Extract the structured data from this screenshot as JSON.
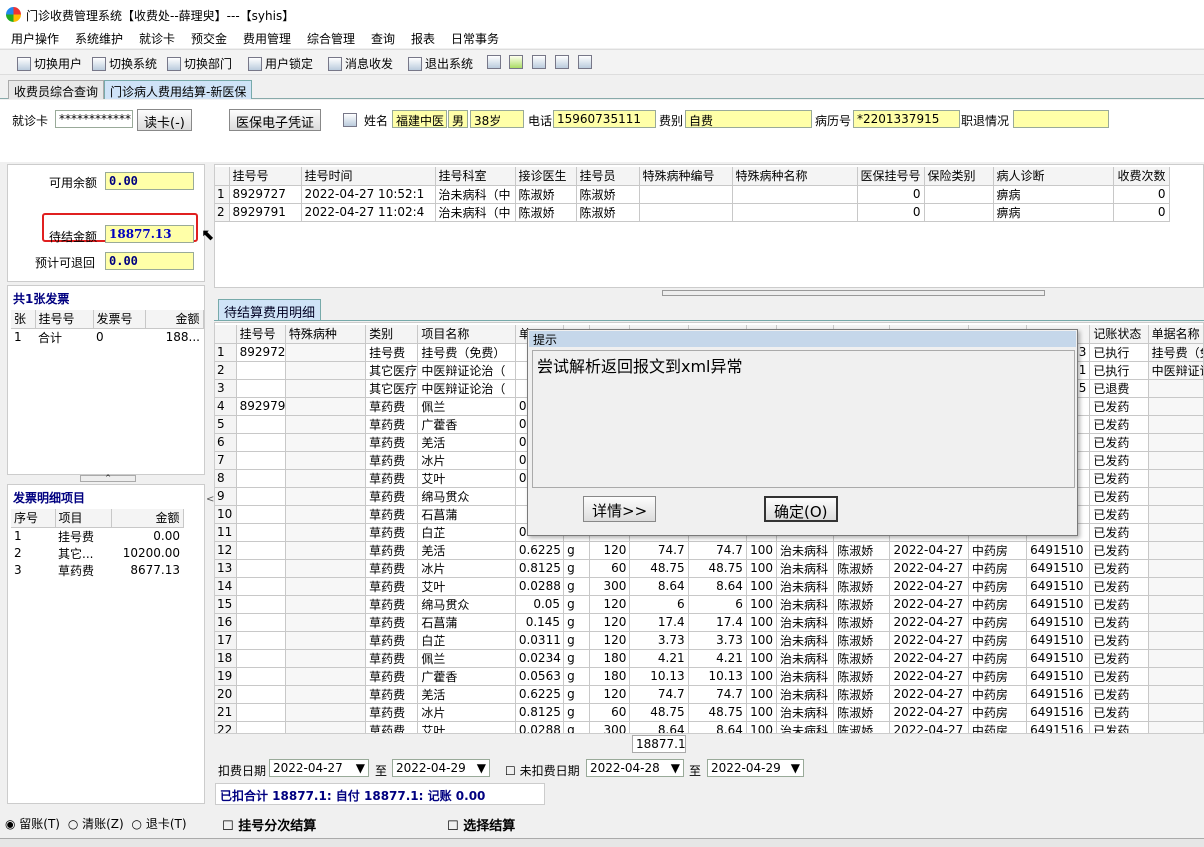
{
  "window": {
    "title": "门诊收费管理系统【收费处--薛理臾】---【syhis】"
  },
  "menu": [
    "用户操作",
    "系统维护",
    "就诊卡",
    "预交金",
    "费用管理",
    "综合管理",
    "查询",
    "报表",
    "日常事务"
  ],
  "toolbar": {
    "switch_user": "切换用户",
    "switch_system": "切换系统",
    "switch_dept": "切换部门",
    "user_lock": "用户锁定",
    "messages": "消息收发",
    "exit": "退出系统"
  },
  "tabs": [
    "收费员综合查询",
    "门诊病人费用结算-新医保"
  ],
  "patient": {
    "card_label": "就诊卡",
    "card_value": "************",
    "read_card": "读卡(-)",
    "medical_voucher": "医保电子凭证",
    "name_label": "姓名",
    "name": "福建中医",
    "gender": "男",
    "age": "38岁",
    "phone_label": "电话",
    "phone": "15960735111",
    "fee_type_label": "费别",
    "fee_type": "自费",
    "record_label": "病历号",
    "record": "*2201337915",
    "refund_label": "职退情况",
    "refund": ""
  },
  "balance": {
    "available_label": "可用余额",
    "available": "0.00",
    "pending_label": "待结金额",
    "pending": "18877.13",
    "refund_label": "预计可退回",
    "refund": "0.00"
  },
  "invoices": {
    "title": "共1张发票",
    "headers": [
      "张",
      "挂号号",
      "发票号",
      "金额"
    ],
    "rows": [
      [
        "1",
        "合计",
        "0",
        "188..."
      ]
    ]
  },
  "invoice_detail": {
    "title": "发票明细项目",
    "headers": [
      "序号",
      "项目",
      "金额"
    ],
    "rows": [
      [
        "1",
        "挂号费",
        "0.00"
      ],
      [
        "2",
        "其它...",
        "10200.00"
      ],
      [
        "3",
        "草药费",
        "8677.13"
      ]
    ]
  },
  "registrations": {
    "headers": [
      "挂号号",
      "挂号时间",
      "挂号科室",
      "接诊医生",
      "挂号员",
      "特殊病种编号",
      "特殊病种名称",
      "医保挂号号",
      "保险类别",
      "病人诊断",
      "收费次数"
    ],
    "rows": [
      [
        "1",
        "8929727",
        "2022-04-27 10:52:1",
        "治未病科（中",
        "陈淑娇",
        "陈淑娇",
        "",
        "",
        "0",
        "",
        "痹病",
        "0"
      ],
      [
        "2",
        "8929791",
        "2022-04-27 11:02:4",
        "治未病科（中",
        "陈淑娇",
        "陈淑娇",
        "",
        "",
        "0",
        "",
        "痹病",
        "0"
      ]
    ]
  },
  "detail": {
    "tab": "待结算费用明细",
    "headers_left": [
      "挂号号",
      "特殊病种",
      "类别",
      "项目名称",
      "单"
    ],
    "headers_right": [
      "记账状态",
      "单据名称"
    ],
    "left_rows": [
      [
        "1",
        "892972",
        "",
        "挂号费",
        "挂号费（免费）",
        ""
      ],
      [
        "2",
        "",
        "",
        "其它医疗",
        "中医辩证论治（",
        ""
      ],
      [
        "3",
        "",
        "",
        "其它医疗",
        "中医辩证论治（",
        ""
      ],
      [
        "4",
        "892979",
        "",
        "草药费",
        "佩兰",
        "0."
      ],
      [
        "5",
        "",
        "",
        "草药费",
        "广藿香",
        "0."
      ],
      [
        "6",
        "",
        "",
        "草药费",
        "羌活",
        "0."
      ],
      [
        "7",
        "",
        "",
        "草药费",
        "冰片",
        "0."
      ],
      [
        "8",
        "",
        "",
        "草药费",
        "艾叶",
        "0."
      ],
      [
        "9",
        "",
        "",
        "草药费",
        "绵马贯众",
        ""
      ],
      [
        "10",
        "",
        "",
        "草药费",
        "石菖蒲",
        ""
      ],
      [
        "11",
        "",
        "",
        "草药费",
        "白芷",
        "0."
      ]
    ],
    "right_rows": [
      [
        "已执行",
        "挂号费（免"
      ],
      [
        "已执行",
        "中医辩证论"
      ],
      [
        "已退费",
        ""
      ],
      [
        "已发药",
        ""
      ],
      [
        "已发药",
        ""
      ],
      [
        "已发药",
        ""
      ],
      [
        "已发药",
        ""
      ],
      [
        "已发药",
        ""
      ],
      [
        "已发药",
        ""
      ],
      [
        "已发药",
        ""
      ],
      [
        "已发药",
        ""
      ]
    ],
    "right_clip": [
      "3",
      "1",
      "5",
      "",
      "",
      "",
      "",
      "",
      "",
      "",
      ""
    ],
    "full_rows": [
      [
        "12",
        "草药费",
        "羌活",
        "0.6225",
        "g",
        "120",
        "74.7",
        "74.7",
        "100",
        "治未病科",
        "陈淑娇",
        "2022-04-27",
        "中药房",
        "6491510",
        "已发药"
      ],
      [
        "13",
        "草药费",
        "冰片",
        "0.8125",
        "g",
        "60",
        "48.75",
        "48.75",
        "100",
        "治未病科",
        "陈淑娇",
        "2022-04-27",
        "中药房",
        "6491510",
        "已发药"
      ],
      [
        "14",
        "草药费",
        "艾叶",
        "0.0288",
        "g",
        "300",
        "8.64",
        "8.64",
        "100",
        "治未病科",
        "陈淑娇",
        "2022-04-27",
        "中药房",
        "6491510",
        "已发药"
      ],
      [
        "15",
        "草药费",
        "绵马贯众",
        "0.05",
        "g",
        "120",
        "6",
        "6",
        "100",
        "治未病科",
        "陈淑娇",
        "2022-04-27",
        "中药房",
        "6491510",
        "已发药"
      ],
      [
        "16",
        "草药费",
        "石菖蒲",
        "0.145",
        "g",
        "120",
        "17.4",
        "17.4",
        "100",
        "治未病科",
        "陈淑娇",
        "2022-04-27",
        "中药房",
        "6491510",
        "已发药"
      ],
      [
        "17",
        "草药费",
        "白芷",
        "0.0311",
        "g",
        "120",
        "3.73",
        "3.73",
        "100",
        "治未病科",
        "陈淑娇",
        "2022-04-27",
        "中药房",
        "6491510",
        "已发药"
      ],
      [
        "18",
        "草药费",
        "佩兰",
        "0.0234",
        "g",
        "180",
        "4.21",
        "4.21",
        "100",
        "治未病科",
        "陈淑娇",
        "2022-04-27",
        "中药房",
        "6491510",
        "已发药"
      ],
      [
        "19",
        "草药费",
        "广藿香",
        "0.0563",
        "g",
        "180",
        "10.13",
        "10.13",
        "100",
        "治未病科",
        "陈淑娇",
        "2022-04-27",
        "中药房",
        "6491510",
        "已发药"
      ],
      [
        "20",
        "草药费",
        "羌活",
        "0.6225",
        "g",
        "120",
        "74.7",
        "74.7",
        "100",
        "治未病科",
        "陈淑娇",
        "2022-04-27",
        "中药房",
        "6491516",
        "已发药"
      ],
      [
        "21",
        "草药费",
        "冰片",
        "0.8125",
        "g",
        "60",
        "48.75",
        "48.75",
        "100",
        "治未病科",
        "陈淑娇",
        "2022-04-27",
        "中药房",
        "6491516",
        "已发药"
      ],
      [
        "22",
        "草药费",
        "艾叶",
        "0.0288",
        "g",
        "300",
        "8.64",
        "8.64",
        "100",
        "治未病科",
        "陈淑娇",
        "2022-04-27",
        "中药房",
        "6491516",
        "已发药"
      ]
    ],
    "total": "18877.1"
  },
  "filter": {
    "deduct_label": "扣费日期",
    "deduct_from": "2022-04-27",
    "to1": "至",
    "deduct_to": "2022-04-29",
    "undeduct_label": "未扣费日期",
    "undeduct_from": "2022-04-28",
    "to2": "至",
    "undeduct_to": "2022-04-29"
  },
  "summary": {
    "text": "已扣合计 18877.1: 自付 18877.1: 记账 0.00"
  },
  "options": {
    "keep": "留账(T)",
    "clear": "清账(Z)",
    "refund": "退卡(T)",
    "split": "挂号分次结算",
    "select": "选择结算"
  },
  "dialog": {
    "title": "提示",
    "message": "尝试解析返回报文到xml异常",
    "details": "详情>>",
    "ok": "确定(O)"
  },
  "colors": {
    "highlight_border": "#e02020",
    "field_bg": "#ffffa8",
    "pending_text": "#0000c0"
  }
}
